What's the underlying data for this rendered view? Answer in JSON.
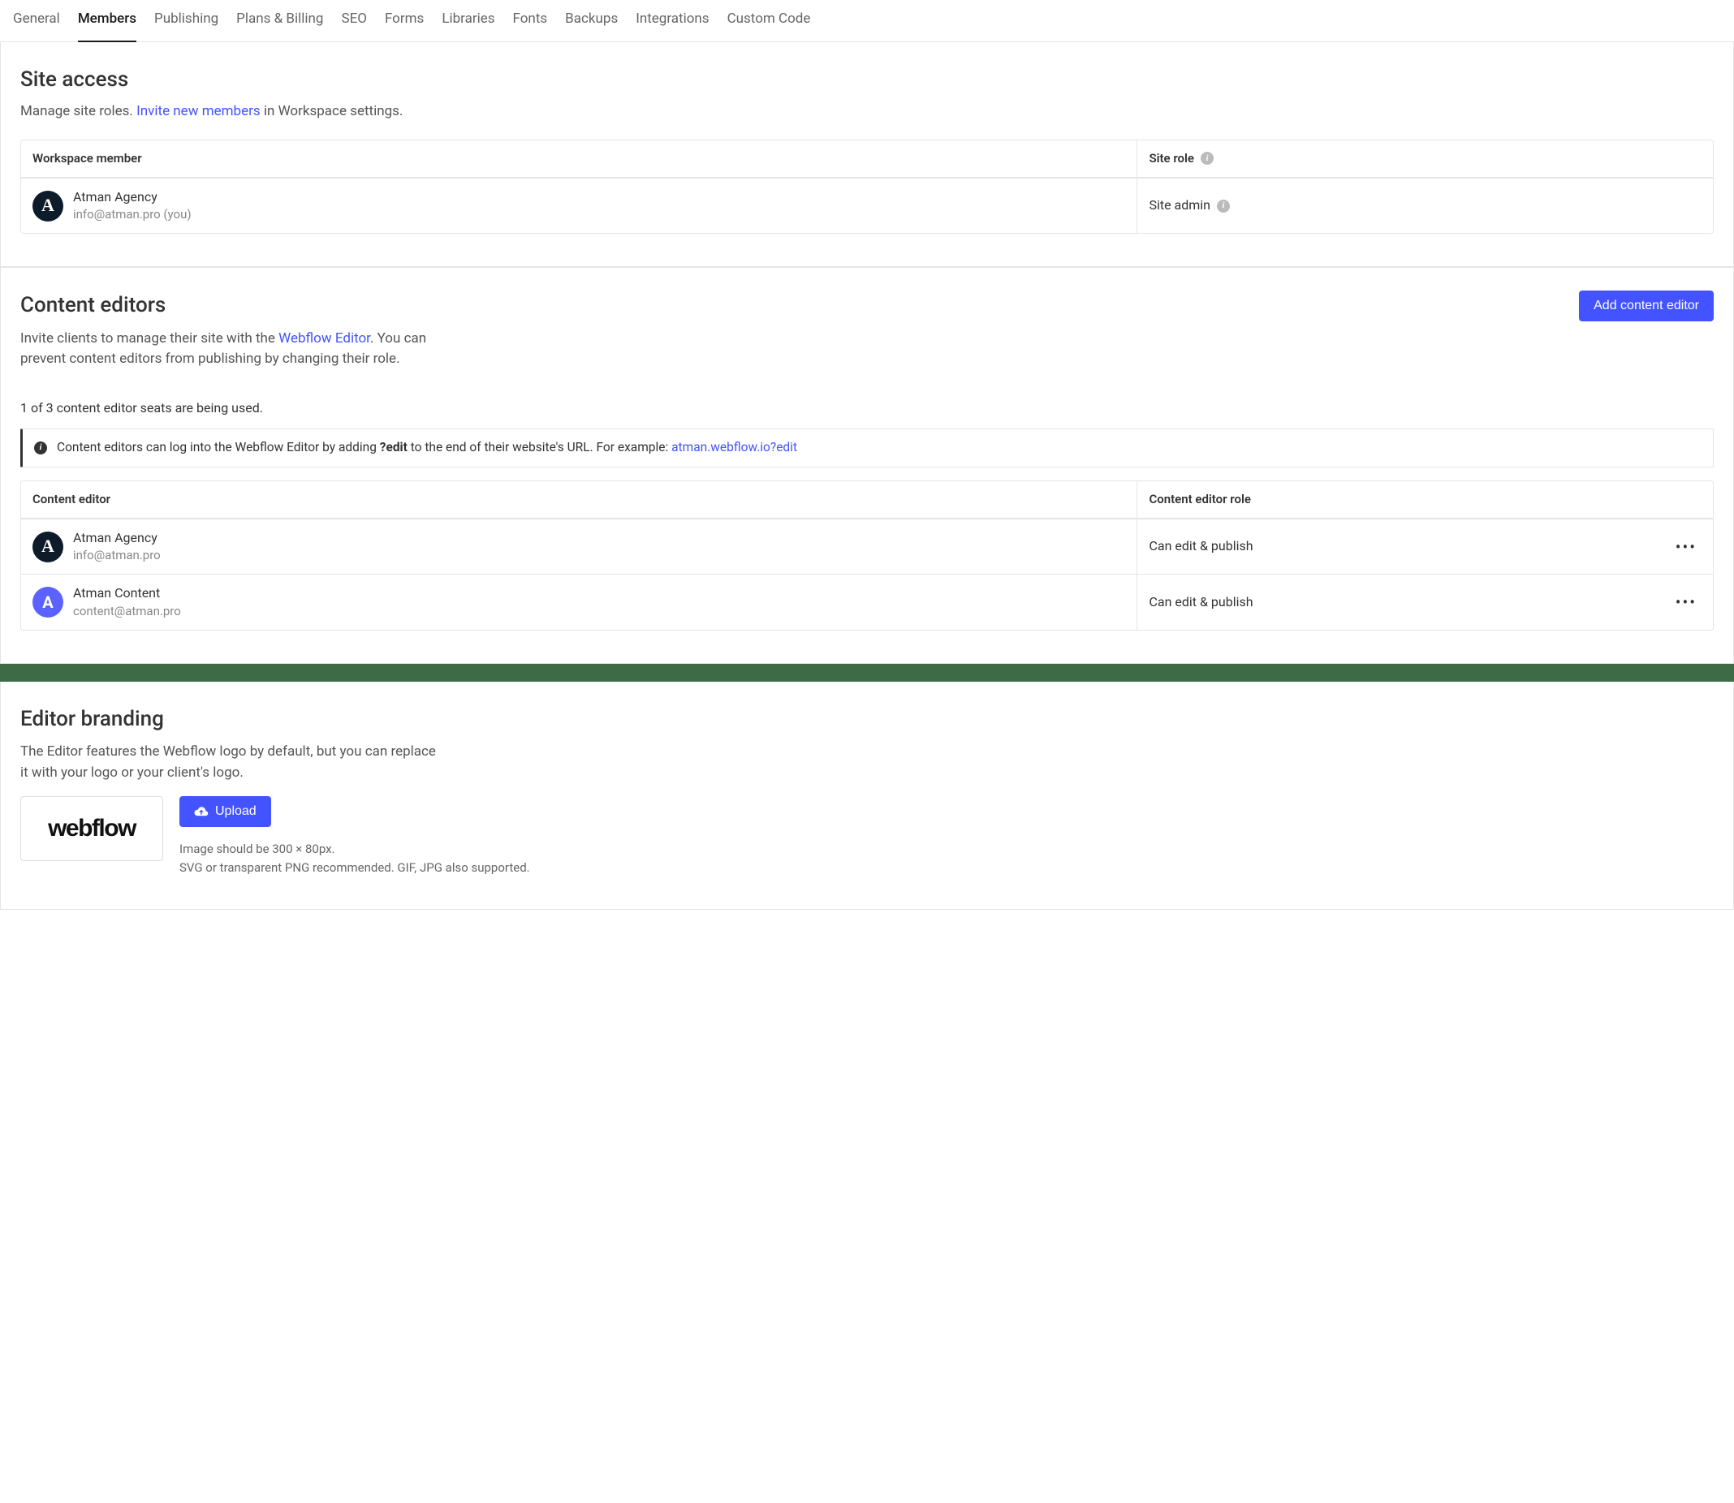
{
  "tabs": {
    "items": [
      {
        "label": "General"
      },
      {
        "label": "Members",
        "active": true
      },
      {
        "label": "Publishing"
      },
      {
        "label": "Plans & Billing"
      },
      {
        "label": "SEO"
      },
      {
        "label": "Forms"
      },
      {
        "label": "Libraries"
      },
      {
        "label": "Fonts"
      },
      {
        "label": "Backups"
      },
      {
        "label": "Integrations"
      },
      {
        "label": "Custom Code"
      }
    ]
  },
  "site_access": {
    "title": "Site access",
    "subtitle_pre": "Manage site roles. ",
    "subtitle_link": "Invite new members",
    "subtitle_post": " in Workspace settings.",
    "header_member": "Workspace member",
    "header_role": "Site role",
    "members": [
      {
        "avatar_letter": "A",
        "avatar_style": "dark",
        "name": "Atman Agency",
        "email": "info@atman.pro (you)",
        "role": "Site admin"
      }
    ]
  },
  "content_editors": {
    "title": "Content editors",
    "add_button": "Add content editor",
    "subtitle_pre": "Invite clients to manage their site with the ",
    "subtitle_link": "Webflow Editor",
    "subtitle_post": ". You can prevent content editors from publishing by changing their role.",
    "seats_note": "1 of 3 content editor seats are being used.",
    "banner_pre": "Content editors can log into the Webflow Editor by adding ",
    "banner_bold": "?edit",
    "banner_mid": " to the end of their website's URL. For example: ",
    "banner_link": "atman.webflow.io?edit",
    "header_member": "Content editor",
    "header_role": "Content editor role",
    "editors": [
      {
        "avatar_letter": "A",
        "avatar_style": "dark",
        "name": "Atman Agency",
        "email": "info@atman.pro",
        "role": "Can edit & publish"
      },
      {
        "avatar_letter": "A",
        "avatar_style": "indigo",
        "name": "Atman Content",
        "email": "content@atman.pro",
        "role": "Can edit & publish"
      }
    ]
  },
  "editor_branding": {
    "title": "Editor branding",
    "subtitle": "The Editor features the Webflow logo by default, but you can replace it with your logo or your client's logo.",
    "logo_text": "webflow",
    "upload_button": "Upload",
    "hint_line1": "Image should be 300 × 80px.",
    "hint_line2": "SVG or transparent PNG recommended. GIF, JPG also supported."
  }
}
